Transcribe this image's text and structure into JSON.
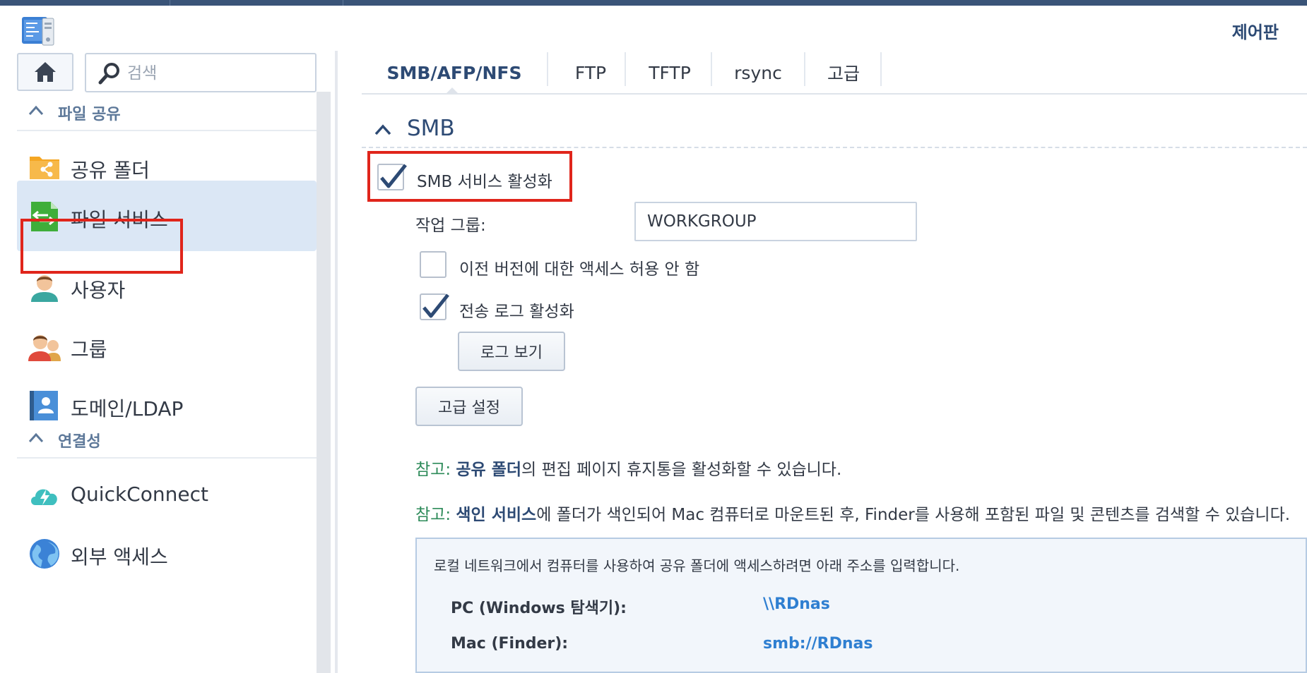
{
  "window": {
    "title": "제어판"
  },
  "sidebar": {
    "search_placeholder": "검색",
    "sections": [
      {
        "label": "파일 공유"
      },
      {
        "label": "연결성"
      }
    ],
    "items": [
      {
        "label": "공유 폴더",
        "icon": "shared-folder-icon"
      },
      {
        "label": "파일 서비스",
        "icon": "file-services-icon",
        "active": true
      },
      {
        "label": "사용자",
        "icon": "user-icon"
      },
      {
        "label": "그룹",
        "icon": "group-icon"
      },
      {
        "label": "도메인/LDAP",
        "icon": "domain-ldap-icon"
      },
      {
        "label": "QuickConnect",
        "icon": "quickconnect-icon"
      },
      {
        "label": "외부 액세스",
        "icon": "external-access-icon"
      }
    ]
  },
  "tabs": [
    {
      "label": "SMB/AFP/NFS",
      "active": true
    },
    {
      "label": "FTP"
    },
    {
      "label": "TFTP"
    },
    {
      "label": "rsync"
    },
    {
      "label": "고급"
    }
  ],
  "smb": {
    "section_title": "SMB",
    "enable_label": "SMB 서비스 활성화",
    "enable_checked": true,
    "workgroup_label": "작업 그룹:",
    "workgroup_value": "WORKGROUP",
    "prev_version_label": "이전 버전에 대한 액세스 허용 안 함",
    "prev_version_checked": false,
    "transfer_log_label": "전송 로그 활성화",
    "transfer_log_checked": true,
    "view_log_button": "로그 보기",
    "advanced_button": "고급 설정",
    "notes": [
      {
        "prefix": "참고:",
        "link": "공유 폴더",
        "rest": "의 편집 페이지 휴지통을 활성화할 수 있습니다."
      },
      {
        "prefix": "참고:",
        "link": "색인 서비스",
        "rest": "에 폴더가 색인되어 Mac 컴퓨터로 마운트된 후, Finder를 사용해 포함된 파일 및 콘텐츠를 검색할 수 있습니다."
      }
    ],
    "info": {
      "description": "로컬 네트워크에서 컴퓨터를 사용하여 공유 폴더에 액세스하려면 아래 주소를 입력합니다.",
      "rows": [
        {
          "key": "PC (Windows 탐색기):",
          "value": "\\\\RDnas"
        },
        {
          "key": "Mac (Finder):",
          "value": "smb://RDnas"
        }
      ]
    }
  },
  "colors": {
    "accent": "#2d4a74",
    "highlight_box": "#e0251b",
    "active_item_bg": "#dbe7f5",
    "note_prefix": "#2e8b5a",
    "link_blue": "#2f7fd1"
  }
}
